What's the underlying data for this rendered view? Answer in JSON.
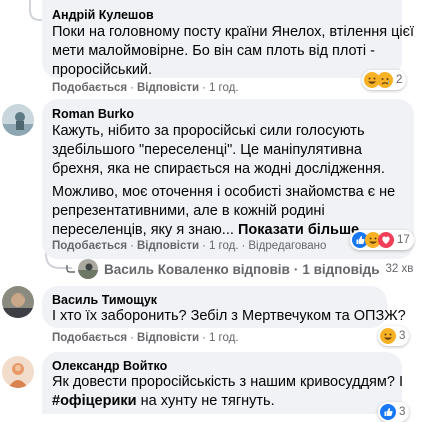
{
  "comments": [
    {
      "author": "Андрій Кулешов",
      "lines": [
        "Поки на головному посту країни Янелох, втілення цієї",
        "мети малоймовірне. Бо він сам плоть від плоті -",
        "проросійський."
      ],
      "like": "Подобається",
      "reply": "Відповісти",
      "time": "1 год.",
      "reaction_count": "2"
    },
    {
      "author": "Roman Burko",
      "lines": [
        "Кажуть, нібито за проросійські сили голосують",
        "здебільшого \"переселенці\". Це маніпулятивна",
        "брехня, яка не спирається на жодні дослідження."
      ],
      "lines2": [
        "Можливо, моє оточення і особисті знайомства є не",
        "репрезентативними, але в кожній родині",
        "переселенців, яку я знаю..."
      ],
      "see_more": "Показати більше...",
      "like": "Подобається",
      "reply": "Відповісти",
      "time": "1 год.",
      "edited": "Відредаговано",
      "reaction_count": "17",
      "replies_summary": {
        "name": "Василь Коваленко відповів",
        "dot": "·",
        "count": "1 відповідь",
        "time": "32 хв"
      }
    },
    {
      "author": "Василь Тимощук",
      "lines": [
        "І хто їх заборонить? Зебіл з Мертвечуком та ОПЗЖ?"
      ],
      "like": "Подобається",
      "reply": "Відповісти",
      "time": "1 год.",
      "reaction_count": "3"
    },
    {
      "author": "Олександр Войтко",
      "lines": [
        "Як довести проросійськість з нашим кривосуддям? І"
      ],
      "hashtag": "#офіцерики",
      "after_hashtag": " на хунту не тягнуть.",
      "reaction_count": "3"
    }
  ],
  "sep": "·",
  "colors": {
    "like_blue": "#1877f2",
    "heart_red": "#f33e58",
    "haha_yellow": "#f7b125",
    "bubble": "#f0f2f5"
  }
}
